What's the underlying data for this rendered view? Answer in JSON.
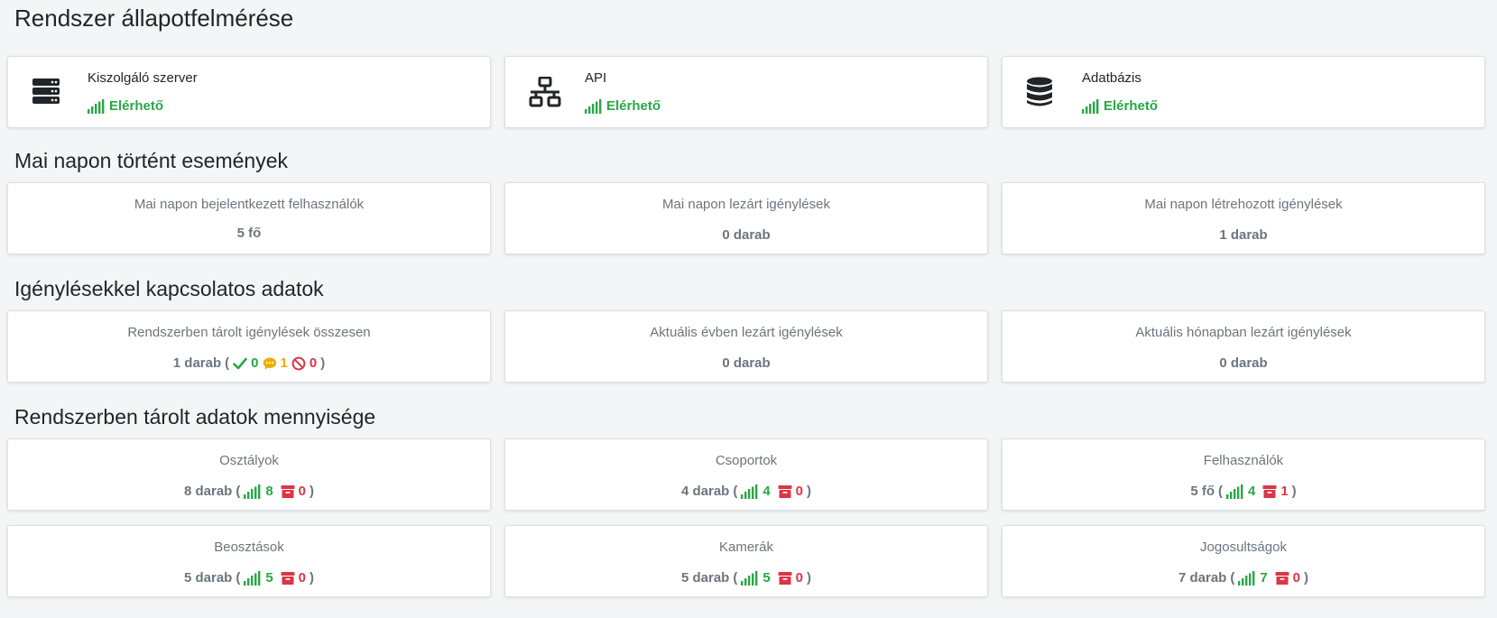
{
  "page": {
    "title": "Rendszer állapotfelmérése"
  },
  "status": [
    {
      "name": "Kiszolgáló szerver",
      "state": "Elérhető",
      "icon": "server-icon"
    },
    {
      "name": "API",
      "state": "Elérhető",
      "icon": "network-icon"
    },
    {
      "name": "Adatbázis",
      "state": "Elérhető",
      "icon": "database-icon"
    }
  ],
  "today": {
    "title": "Mai napon történt események",
    "cards": [
      {
        "label": "Mai napon bejelentkezett felhasználók",
        "value": "5 fő"
      },
      {
        "label": "Mai napon lezárt igénylések",
        "value": "0 darab"
      },
      {
        "label": "Mai napon létrehozott igénylések",
        "value": "1 darab"
      }
    ]
  },
  "requests": {
    "title": "Igénylésekkel kapcsolatos adatok",
    "total": {
      "label": "Rendszerben tárolt igénylések összesen",
      "value": "1 darab",
      "open": "(",
      "approved": "0",
      "pending": "1",
      "rejected": "0",
      "close": ")"
    },
    "cards": [
      {
        "label": "Aktuális évben lezárt igénylések",
        "value": "0 darab"
      },
      {
        "label": "Aktuális hónapban lezárt igénylések",
        "value": "0 darab"
      }
    ]
  },
  "stored": {
    "title": "Rendszerben tárolt adatok mennyisége",
    "open": "(",
    "close": ")",
    "cards": [
      {
        "label": "Osztályok",
        "value": "8 darab",
        "active": "8",
        "archived": "0"
      },
      {
        "label": "Csoportok",
        "value": "4 darab",
        "active": "4",
        "archived": "0"
      },
      {
        "label": "Felhasználók",
        "value": "5 fő",
        "active": "4",
        "archived": "1"
      },
      {
        "label": "Beosztások",
        "value": "5 darab",
        "active": "5",
        "archived": "0"
      },
      {
        "label": "Kamerák",
        "value": "5 darab",
        "active": "5",
        "archived": "0"
      },
      {
        "label": "Jogosultságok",
        "value": "7 darab",
        "active": "7",
        "archived": "0"
      }
    ]
  },
  "colors": {
    "success": "#28a745",
    "warning": "#f0ad00",
    "danger": "#dc3545",
    "muted": "#6c757d"
  }
}
